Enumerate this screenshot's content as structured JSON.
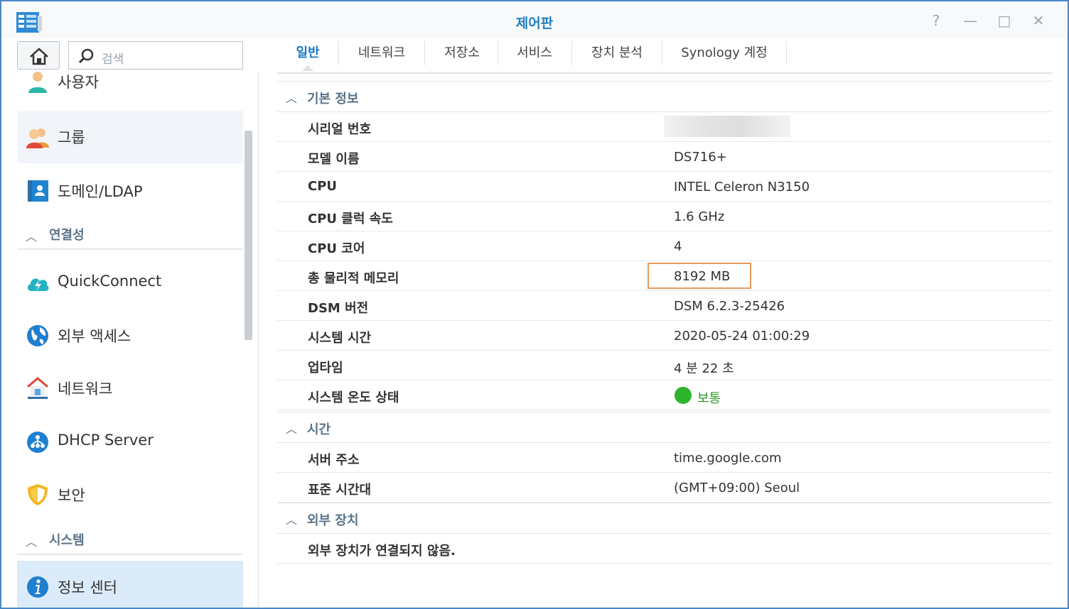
{
  "window": {
    "title": "제어판"
  },
  "titlebar_buttons": {
    "help": "?",
    "minimize": "—",
    "maximize": "□",
    "close": "✕"
  },
  "sidebar": {
    "search_placeholder": "검색",
    "items": [
      {
        "label": "사용자",
        "icon": "user-icon"
      },
      {
        "label": "그룹",
        "icon": "group-icon"
      },
      {
        "label": "도메인/LDAP",
        "icon": "domain-ldap-icon"
      }
    ],
    "section_connectivity": "연결성",
    "connectivity_items": [
      {
        "label": "QuickConnect",
        "icon": "quickconnect-icon"
      },
      {
        "label": "외부 액세스",
        "icon": "globe-icon"
      },
      {
        "label": "네트워크",
        "icon": "network-house-icon"
      },
      {
        "label": "DHCP Server",
        "icon": "dhcp-icon"
      },
      {
        "label": "보안",
        "icon": "shield-icon"
      }
    ],
    "section_system": "시스템",
    "system_items": [
      {
        "label": "정보 센터",
        "icon": "info-icon"
      }
    ]
  },
  "tabs": [
    {
      "label": "일반",
      "active": true
    },
    {
      "label": "네트워크"
    },
    {
      "label": "저장소"
    },
    {
      "label": "서비스"
    },
    {
      "label": "장치 분석"
    },
    {
      "label": "Synology 계정"
    }
  ],
  "sections": {
    "basic": {
      "title": "기본 정보",
      "rows": [
        {
          "key": "시리얼 번호",
          "value": ""
        },
        {
          "key": "모델 이름",
          "value": "DS716+"
        },
        {
          "key": "CPU",
          "value": "INTEL Celeron N3150"
        },
        {
          "key": "CPU 클럭 속도",
          "value": "1.6 GHz"
        },
        {
          "key": "CPU 코어",
          "value": "4"
        },
        {
          "key": "총 물리적 메모리",
          "value": "8192 MB"
        },
        {
          "key": "DSM 버전",
          "value": "DSM 6.2.3-25426"
        },
        {
          "key": "시스템 시간",
          "value": "2020-05-24 01:00:29"
        },
        {
          "key": "업타임",
          "value": "4 분 22 초"
        },
        {
          "key": "시스템 온도 상태",
          "value": "보통"
        }
      ]
    },
    "time": {
      "title": "시간",
      "rows": [
        {
          "key": "서버 주소",
          "value": "time.google.com"
        },
        {
          "key": "표준 시간대",
          "value": "(GMT+09:00) Seoul"
        }
      ]
    },
    "external": {
      "title": "외부 장치",
      "message": "외부 장치가 연결되지 않음."
    }
  },
  "colors": {
    "accent": "#1877c6",
    "status_ok": "#2db52d",
    "highlight_border": "#e89a5c",
    "active_nav": "#dcebf9"
  }
}
